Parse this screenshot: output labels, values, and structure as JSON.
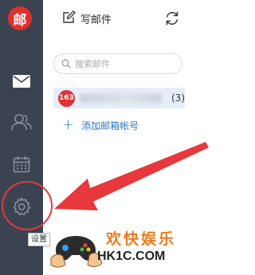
{
  "sidebar": {
    "logo": "邮",
    "icons": [
      "mail-icon",
      "contacts-icon",
      "calendar-icon",
      "settings-icon"
    ],
    "settings_tooltip": "设置"
  },
  "toolbar": {
    "compose_label": "写邮件",
    "refresh_icon": "refresh-icon"
  },
  "search": {
    "placeholder": "搜索邮件"
  },
  "account": {
    "provider_badge": "163",
    "unread_count": "(3)"
  },
  "add_account": {
    "label": "添加邮箱帐号"
  },
  "watermark": {
    "title": "欢快娱乐",
    "domain": "HK1C.COM"
  },
  "colors": {
    "sidebar_bg": "#3b4350",
    "brand_red": "#e0302b",
    "link_blue": "#2a78c9",
    "annotation_red": "#e8383b",
    "selected_row": "#e5edf8"
  }
}
